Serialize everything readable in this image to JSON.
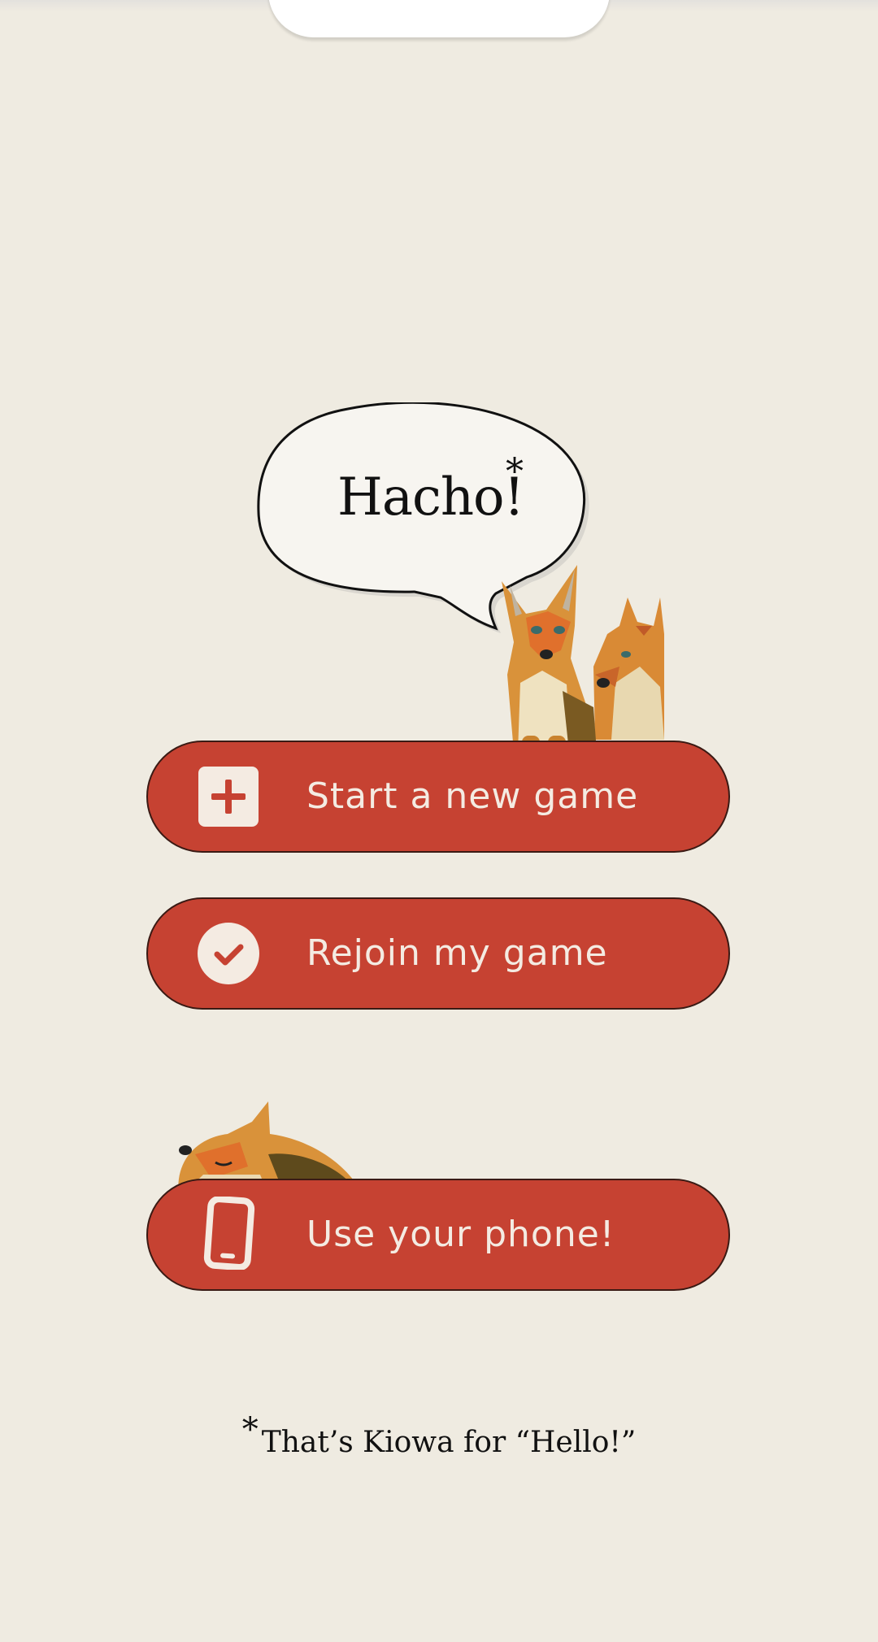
{
  "greeting": {
    "bubble_text": "Hacho!",
    "asterisk": "*"
  },
  "buttons": {
    "start": {
      "label": "Start a new game",
      "icon": "plus-square-icon"
    },
    "rejoin": {
      "label": "Rejoin my game",
      "icon": "check-circle-icon"
    },
    "phone": {
      "label": "Use your phone!",
      "icon": "phone-icon"
    }
  },
  "footnote": {
    "asterisk": "*",
    "text": "That’s Kiowa for “Hello!”"
  },
  "colors": {
    "background": "#efebe1",
    "button": "#c64232",
    "button_text": "#f4ebe2",
    "bubble": "#f7f5f0"
  }
}
